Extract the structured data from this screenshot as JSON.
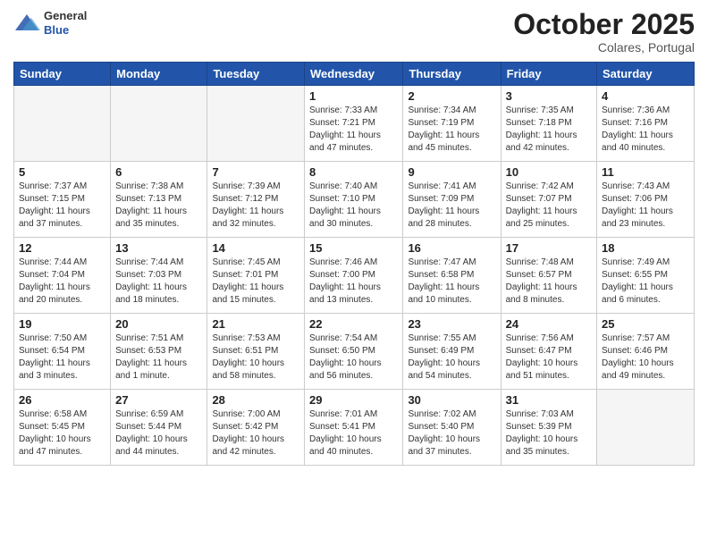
{
  "header": {
    "logo_general": "General",
    "logo_blue": "Blue",
    "month": "October 2025",
    "location": "Colares, Portugal"
  },
  "weekdays": [
    "Sunday",
    "Monday",
    "Tuesday",
    "Wednesday",
    "Thursday",
    "Friday",
    "Saturday"
  ],
  "weeks": [
    [
      {
        "day": "",
        "info": ""
      },
      {
        "day": "",
        "info": ""
      },
      {
        "day": "",
        "info": ""
      },
      {
        "day": "1",
        "info": "Sunrise: 7:33 AM\nSunset: 7:21 PM\nDaylight: 11 hours\nand 47 minutes."
      },
      {
        "day": "2",
        "info": "Sunrise: 7:34 AM\nSunset: 7:19 PM\nDaylight: 11 hours\nand 45 minutes."
      },
      {
        "day": "3",
        "info": "Sunrise: 7:35 AM\nSunset: 7:18 PM\nDaylight: 11 hours\nand 42 minutes."
      },
      {
        "day": "4",
        "info": "Sunrise: 7:36 AM\nSunset: 7:16 PM\nDaylight: 11 hours\nand 40 minutes."
      }
    ],
    [
      {
        "day": "5",
        "info": "Sunrise: 7:37 AM\nSunset: 7:15 PM\nDaylight: 11 hours\nand 37 minutes."
      },
      {
        "day": "6",
        "info": "Sunrise: 7:38 AM\nSunset: 7:13 PM\nDaylight: 11 hours\nand 35 minutes."
      },
      {
        "day": "7",
        "info": "Sunrise: 7:39 AM\nSunset: 7:12 PM\nDaylight: 11 hours\nand 32 minutes."
      },
      {
        "day": "8",
        "info": "Sunrise: 7:40 AM\nSunset: 7:10 PM\nDaylight: 11 hours\nand 30 minutes."
      },
      {
        "day": "9",
        "info": "Sunrise: 7:41 AM\nSunset: 7:09 PM\nDaylight: 11 hours\nand 28 minutes."
      },
      {
        "day": "10",
        "info": "Sunrise: 7:42 AM\nSunset: 7:07 PM\nDaylight: 11 hours\nand 25 minutes."
      },
      {
        "day": "11",
        "info": "Sunrise: 7:43 AM\nSunset: 7:06 PM\nDaylight: 11 hours\nand 23 minutes."
      }
    ],
    [
      {
        "day": "12",
        "info": "Sunrise: 7:44 AM\nSunset: 7:04 PM\nDaylight: 11 hours\nand 20 minutes."
      },
      {
        "day": "13",
        "info": "Sunrise: 7:44 AM\nSunset: 7:03 PM\nDaylight: 11 hours\nand 18 minutes."
      },
      {
        "day": "14",
        "info": "Sunrise: 7:45 AM\nSunset: 7:01 PM\nDaylight: 11 hours\nand 15 minutes."
      },
      {
        "day": "15",
        "info": "Sunrise: 7:46 AM\nSunset: 7:00 PM\nDaylight: 11 hours\nand 13 minutes."
      },
      {
        "day": "16",
        "info": "Sunrise: 7:47 AM\nSunset: 6:58 PM\nDaylight: 11 hours\nand 10 minutes."
      },
      {
        "day": "17",
        "info": "Sunrise: 7:48 AM\nSunset: 6:57 PM\nDaylight: 11 hours\nand 8 minutes."
      },
      {
        "day": "18",
        "info": "Sunrise: 7:49 AM\nSunset: 6:55 PM\nDaylight: 11 hours\nand 6 minutes."
      }
    ],
    [
      {
        "day": "19",
        "info": "Sunrise: 7:50 AM\nSunset: 6:54 PM\nDaylight: 11 hours\nand 3 minutes."
      },
      {
        "day": "20",
        "info": "Sunrise: 7:51 AM\nSunset: 6:53 PM\nDaylight: 11 hours\nand 1 minute."
      },
      {
        "day": "21",
        "info": "Sunrise: 7:53 AM\nSunset: 6:51 PM\nDaylight: 10 hours\nand 58 minutes."
      },
      {
        "day": "22",
        "info": "Sunrise: 7:54 AM\nSunset: 6:50 PM\nDaylight: 10 hours\nand 56 minutes."
      },
      {
        "day": "23",
        "info": "Sunrise: 7:55 AM\nSunset: 6:49 PM\nDaylight: 10 hours\nand 54 minutes."
      },
      {
        "day": "24",
        "info": "Sunrise: 7:56 AM\nSunset: 6:47 PM\nDaylight: 10 hours\nand 51 minutes."
      },
      {
        "day": "25",
        "info": "Sunrise: 7:57 AM\nSunset: 6:46 PM\nDaylight: 10 hours\nand 49 minutes."
      }
    ],
    [
      {
        "day": "26",
        "info": "Sunrise: 6:58 AM\nSunset: 5:45 PM\nDaylight: 10 hours\nand 47 minutes."
      },
      {
        "day": "27",
        "info": "Sunrise: 6:59 AM\nSunset: 5:44 PM\nDaylight: 10 hours\nand 44 minutes."
      },
      {
        "day": "28",
        "info": "Sunrise: 7:00 AM\nSunset: 5:42 PM\nDaylight: 10 hours\nand 42 minutes."
      },
      {
        "day": "29",
        "info": "Sunrise: 7:01 AM\nSunset: 5:41 PM\nDaylight: 10 hours\nand 40 minutes."
      },
      {
        "day": "30",
        "info": "Sunrise: 7:02 AM\nSunset: 5:40 PM\nDaylight: 10 hours\nand 37 minutes."
      },
      {
        "day": "31",
        "info": "Sunrise: 7:03 AM\nSunset: 5:39 PM\nDaylight: 10 hours\nand 35 minutes."
      },
      {
        "day": "",
        "info": ""
      }
    ]
  ]
}
